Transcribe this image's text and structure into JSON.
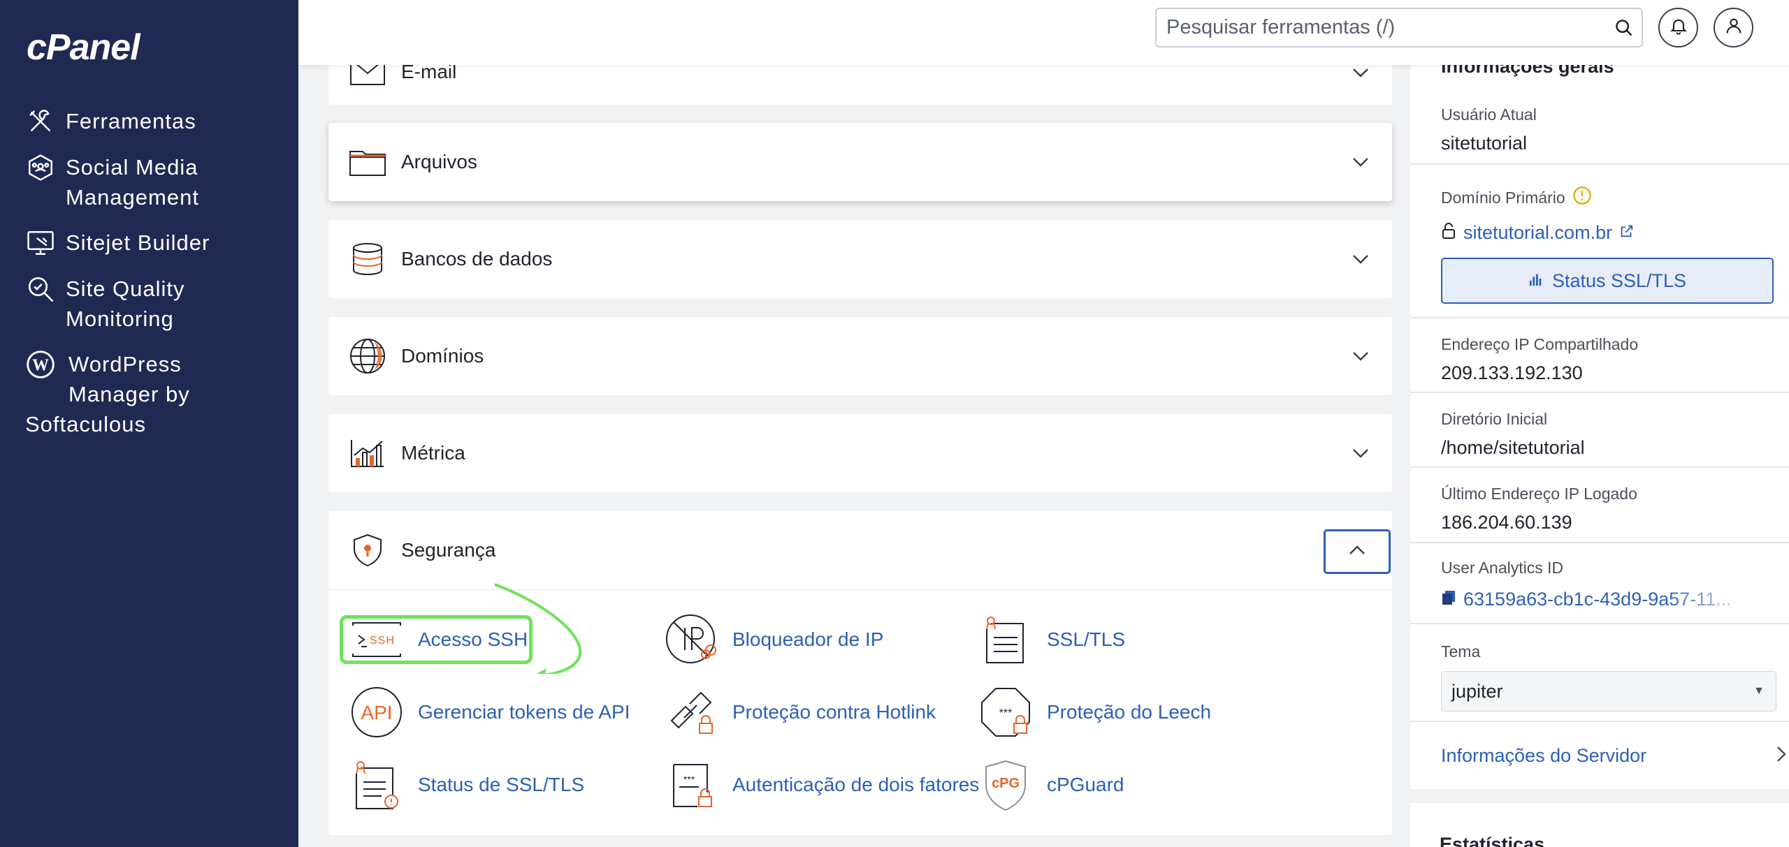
{
  "app": {
    "logo_text": "cPanel"
  },
  "sidebar": {
    "items": [
      {
        "label": "Ferramentas",
        "icon": "tools-icon"
      },
      {
        "label_line1": "Social Media",
        "label_line2": "Management",
        "icon": "social-media-icon"
      },
      {
        "label": "Sitejet Builder",
        "icon": "sitejet-icon"
      },
      {
        "label_line1": "Site Quality",
        "label_line2": "Monitoring",
        "icon": "site-quality-icon"
      },
      {
        "label_line1": "WordPress",
        "label_line2": "Manager by",
        "label_line3": "Softaculous",
        "icon": "wordpress-icon"
      }
    ]
  },
  "topbar": {
    "search_placeholder": "Pesquisar ferramentas (/)"
  },
  "panels": {
    "email": {
      "title": "E-mail"
    },
    "arquivos": {
      "title": "Arquivos"
    },
    "bancos": {
      "title": "Bancos de dados"
    },
    "dominios": {
      "title": "Domínios"
    },
    "metrica": {
      "title": "Métrica"
    },
    "seguranca": {
      "title": "Segurança",
      "tools": [
        {
          "label": "Acesso SSH",
          "icon": "ssh-icon"
        },
        {
          "label": "Bloqueador de IP",
          "icon": "ip-blocker-icon"
        },
        {
          "label": "SSL/TLS",
          "icon": "ssl-certificate-icon"
        },
        {
          "label": "Gerenciar tokens de API",
          "icon": "api-icon"
        },
        {
          "label": "Proteção contra Hotlink",
          "icon": "hotlink-icon"
        },
        {
          "label": "Proteção do Leech",
          "icon": "leech-icon"
        },
        {
          "label": "Status de SSL/TLS",
          "icon": "ssl-status-icon"
        },
        {
          "label": "Autenticação de dois fatores",
          "icon": "two-factor-icon"
        },
        {
          "label": "cPGuard",
          "icon": "cpguard-icon"
        }
      ]
    }
  },
  "info": {
    "heading": "Informações gerais",
    "usuario_label": "Usuário Atual",
    "usuario_value": "sitetutorial",
    "dominio_label": "Domínio Primário",
    "dominio_value": "sitetutorial.com.br",
    "ssl_button": "Status SSL/TLS",
    "ip_label": "Endereço IP Compartilhado",
    "ip_value": "209.133.192.130",
    "dir_label": "Diretório Inicial",
    "dir_value": "/home/sitetutorial",
    "last_ip_label": "Último Endereço IP Logado",
    "last_ip_value": "186.204.60.139",
    "analytics_label": "User Analytics ID",
    "analytics_value": "63159a63-cb1c-43d9-9a57-11...",
    "tema_label": "Tema",
    "tema_value": "jupiter",
    "server_info_link": "Informações do Servidor",
    "stats_heading": "Estatísticas"
  },
  "colors": {
    "sidebar_bg": "#1f2a53",
    "link": "#2c5fb8",
    "accent_orange": "#e8652c",
    "highlight_green": "#6fe35a"
  }
}
